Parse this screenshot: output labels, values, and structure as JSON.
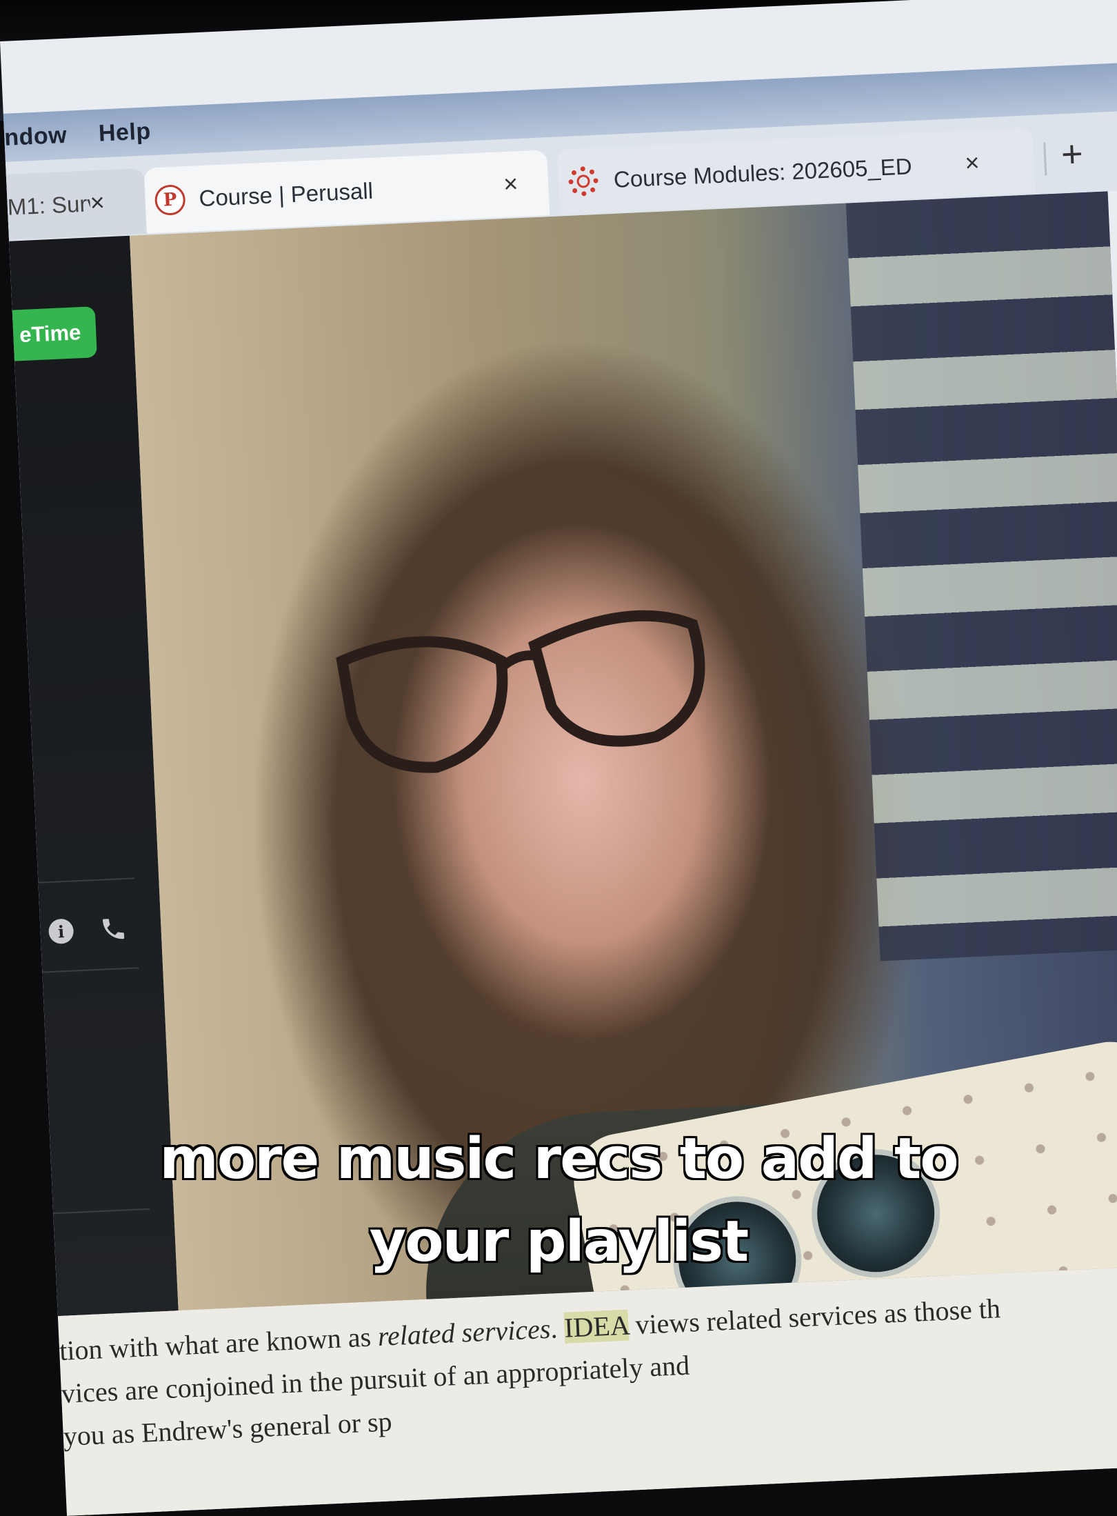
{
  "menubar": {
    "items": [
      "ndow",
      "Help"
    ]
  },
  "tabs": [
    {
      "label": "M1: Surv",
      "close": "×"
    },
    {
      "label": "Course | Perusall",
      "favicon": "P",
      "close": "×"
    },
    {
      "label": "Course Modules: 202605_ED",
      "close": "×"
    }
  ],
  "new_tab": "+",
  "facetime": {
    "button_label": "eTime",
    "info_glyph": "i"
  },
  "caption": {
    "line1": "more music recs to add to",
    "line2": "your playlist"
  },
  "document": {
    "line1_a": "tion with what are known as ",
    "line1_b": "related services",
    "line1_c": ". ",
    "line1_hl": "IDEA",
    "line1_d": " views related services as those th",
    "line2": "vices are conjoined in the pursuit of an appropriately and",
    "line3": "you as Endrew's general or sp"
  },
  "colors": {
    "facetime_green": "#34b550",
    "highlight": "#d6dba8",
    "perusall_red": "#c0392b"
  }
}
